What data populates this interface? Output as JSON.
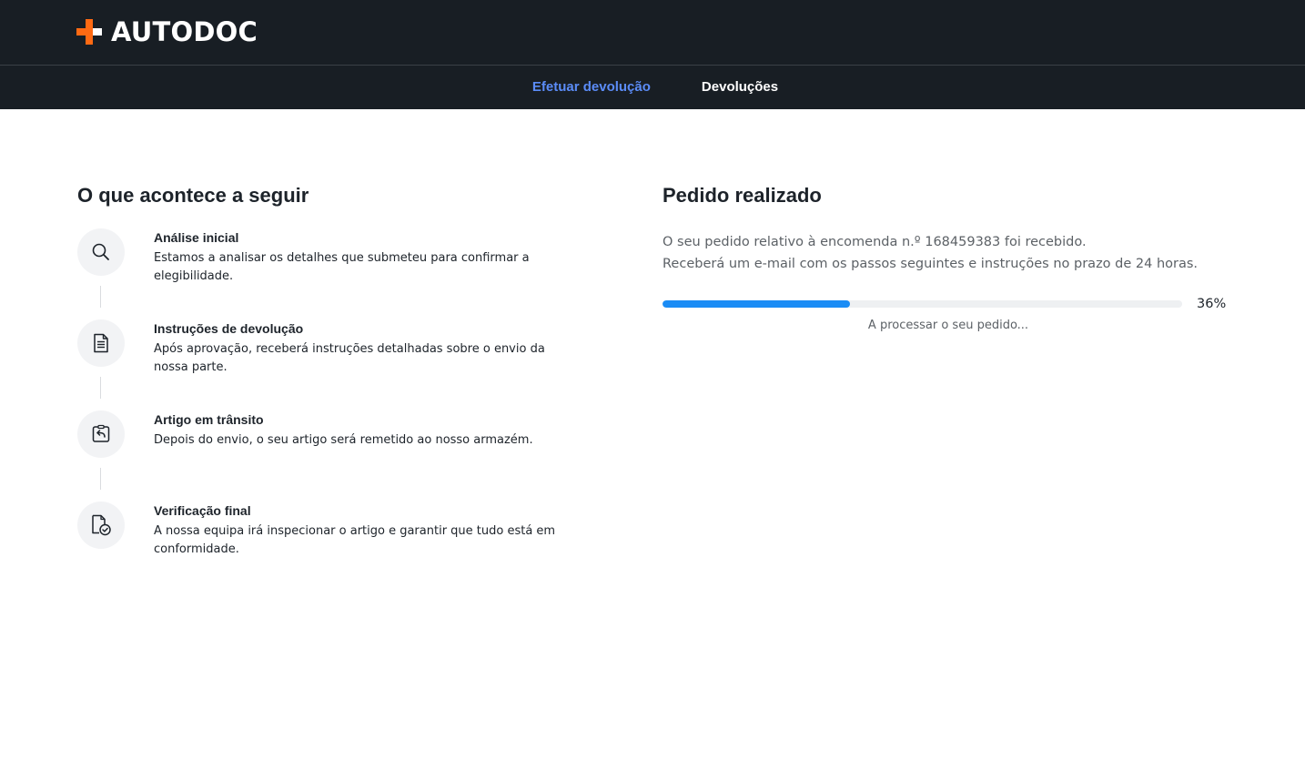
{
  "brand": {
    "name": "AUTODOC",
    "logo_icon": "cross-icon",
    "colors": {
      "header_bg": "#181e24",
      "accent_orange": "#ff6a13",
      "nav_active": "#5b8cf7",
      "progress": "#1a8cf5"
    }
  },
  "nav": {
    "items": [
      {
        "label": "Efetuar devolução",
        "active": true
      },
      {
        "label": "Devoluções",
        "active": false
      }
    ]
  },
  "next_steps": {
    "title": "O que acontece a seguir",
    "steps": [
      {
        "icon": "search-icon",
        "title": "Análise inicial",
        "description": "Estamos a analisar os detalhes que submeteu para confirmar a elegibilidade."
      },
      {
        "icon": "document-icon",
        "title": "Instruções de devolução",
        "description": "Após aprovação, receberá instruções detalhadas sobre o envio da nossa parte."
      },
      {
        "icon": "return-package-icon",
        "title": "Artigo em trânsito",
        "description": "Depois do envio, o seu artigo será remetido ao nosso armazém."
      },
      {
        "icon": "document-check-icon",
        "title": "Verificação final",
        "description": "A nossa equipa irá inspecionar o artigo e garantir que tudo está em conformidade."
      }
    ]
  },
  "order": {
    "title": "Pedido realizado",
    "line1": "O seu pedido relativo à encomenda n.º 168459383 foi recebido.",
    "line2": "Receberá um e-mail com os passos seguintes e instruções no prazo de 24 horas.",
    "progress_percent": 36,
    "progress_label": "36%",
    "status_text": "A processar o seu pedido..."
  }
}
